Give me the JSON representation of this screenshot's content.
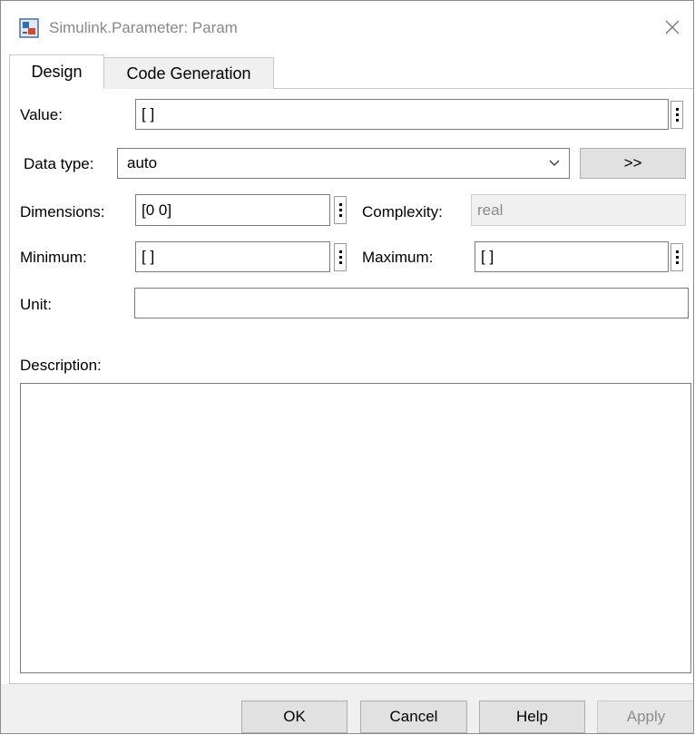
{
  "window": {
    "title": "Simulink.Parameter: Param",
    "app_icon": "simulink-icon",
    "close_icon": "close-icon"
  },
  "tabs": [
    {
      "label": "Design",
      "selected": true
    },
    {
      "label": "Code Generation",
      "selected": false
    }
  ],
  "form": {
    "value_label": "Value:",
    "value": "[ ]",
    "data_type_label": "Data type:",
    "data_type": "auto",
    "data_type_assistant_label": ">>",
    "dimensions_label": "Dimensions:",
    "dimensions": "[0 0]",
    "complexity_label": "Complexity:",
    "complexity": "real",
    "minimum_label": "Minimum:",
    "minimum": "[ ]",
    "maximum_label": "Maximum:",
    "maximum": "[ ]",
    "unit_label": "Unit:",
    "unit": "",
    "description_label": "Description:",
    "description": ""
  },
  "buttons": {
    "ok": "OK",
    "cancel": "Cancel",
    "help": "Help",
    "apply": "Apply"
  },
  "icons": {
    "kebab": "more-options-icon",
    "chevron": "chevron-down-icon"
  }
}
